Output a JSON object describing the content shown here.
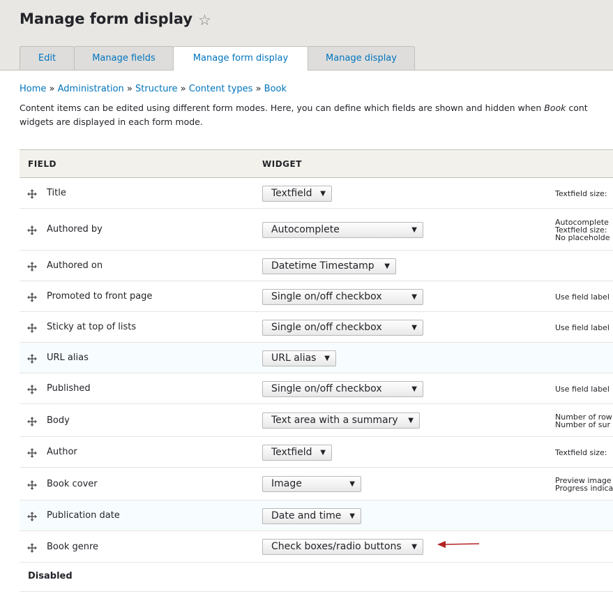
{
  "header": {
    "title": "Manage form display",
    "star_icon": "star-outline-icon",
    "tabs": [
      {
        "label": "Edit"
      },
      {
        "label": "Manage fields"
      },
      {
        "label": "Manage form display",
        "active": true
      },
      {
        "label": "Manage display"
      }
    ]
  },
  "breadcrumb": {
    "items": [
      "Home",
      "Administration",
      "Structure",
      "Content types",
      "Book"
    ],
    "separator": "»"
  },
  "description": {
    "line1_before": "Content items can be edited using different form modes. Here, you can define which fields are shown and hidden when ",
    "line1_em": "Book",
    "line1_after": " cont",
    "line2": "widgets are displayed in each form mode."
  },
  "table": {
    "headers": {
      "field": "FIELD",
      "widget": "WIDGET"
    },
    "rows": [
      {
        "field": "Title",
        "widget": "Textfield",
        "summary": [
          "Textfield size:"
        ],
        "alt": false
      },
      {
        "field": "Authored by",
        "widget": "Autocomplete",
        "summary": [
          "Autocomplete",
          "Textfield size:",
          "No placeholde"
        ],
        "alt": false
      },
      {
        "field": "Authored on",
        "widget": "Datetime Timestamp",
        "summary": [],
        "alt": false
      },
      {
        "field": "Promoted to front page",
        "widget": "Single on/off checkbox",
        "summary": [
          "Use field label"
        ],
        "alt": false
      },
      {
        "field": "Sticky at top of lists",
        "widget": "Single on/off checkbox",
        "summary": [
          "Use field label"
        ],
        "alt": false
      },
      {
        "field": "URL alias",
        "widget": "URL alias",
        "summary": [],
        "alt": true
      },
      {
        "field": "Published",
        "widget": "Single on/off checkbox",
        "summary": [
          "Use field label"
        ],
        "alt": false
      },
      {
        "field": "Body",
        "widget": "Text area with a summary",
        "summary": [
          "Number of row",
          "Number of sur"
        ],
        "alt": false
      },
      {
        "field": "Author",
        "widget": "Textfield",
        "summary": [
          "Textfield size:"
        ],
        "alt": false
      },
      {
        "field": "Book cover",
        "widget": "Image",
        "summary": [
          "Preview image",
          "Progress indica"
        ],
        "alt": false
      },
      {
        "field": "Publication date",
        "widget": "Date and time",
        "summary": [],
        "alt": true
      },
      {
        "field": "Book genre",
        "widget": "Check boxes/radio buttons",
        "summary": [],
        "alt": false
      }
    ],
    "disabled_label": "Disabled"
  },
  "colors": {
    "link": "#0074bd",
    "header_bg": "#e8e7e3",
    "annotation_arrow": "#b22222"
  }
}
